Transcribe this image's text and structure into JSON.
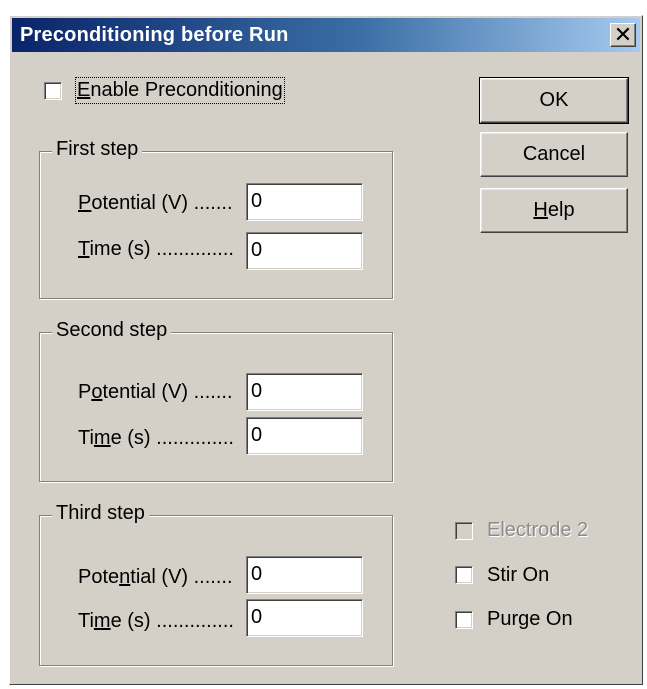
{
  "window": {
    "title": "Preconditioning before Run",
    "close_glyph": "✕",
    "close_icon": "close-icon"
  },
  "enable": {
    "pre": "",
    "accel": "E",
    "post": "nable Preconditioning",
    "checked": false
  },
  "buttons": {
    "ok": "OK",
    "cancel": "Cancel",
    "help": {
      "pre": "",
      "accel": "H",
      "post": "elp"
    }
  },
  "groups": [
    {
      "title": "First step",
      "potential": {
        "pre": "",
        "accel": "P",
        "post": "otential (V) .......",
        "value": "0"
      },
      "time": {
        "pre": "",
        "accel": "T",
        "post": "ime (s) ..............",
        "value": "0"
      }
    },
    {
      "title": "Second step",
      "potential": {
        "pre": "P",
        "accel": "o",
        "post": "tential (V) .......",
        "value": "0"
      },
      "time": {
        "pre": "Ti",
        "accel": "m",
        "post": "e (s) ..............",
        "value": "0"
      }
    },
    {
      "title": "Third step",
      "potential": {
        "pre": "Pote",
        "accel": "n",
        "post": "tial (V) .......",
        "value": "0"
      },
      "time": {
        "pre": "Ti",
        "accel": "m",
        "post": "e (s) ..............",
        "value": "0"
      }
    }
  ],
  "options": {
    "electrode2": {
      "label": "Electrode 2",
      "checked": false,
      "enabled": false
    },
    "stir": {
      "label": "Stir On",
      "checked": false
    },
    "purge": {
      "label": "Purge On",
      "checked": false
    }
  }
}
